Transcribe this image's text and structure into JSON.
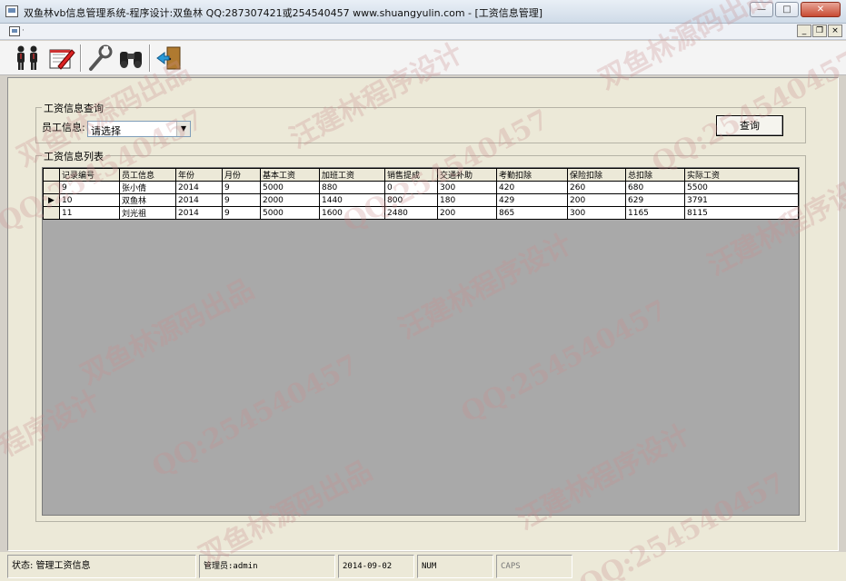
{
  "window": {
    "title": "双鱼林vb信息管理系统-程序设计:双鱼林 QQ:287307421或254540457 www.shuangyulin.com - [工资信息管理]",
    "controls": [
      "minimize",
      "maximize",
      "close"
    ]
  },
  "mdi": {
    "controls": [
      "minimize",
      "restore",
      "close"
    ]
  },
  "toolbar": {
    "icons": [
      "employees-icon",
      "edit-record-icon",
      "tools-icon",
      "search-binoculars-icon",
      "exit-door-icon"
    ]
  },
  "query": {
    "frame_title": "工资信息查询",
    "employee_label": "员工信息:",
    "employee_select_value": "请选择",
    "query_button": "查询"
  },
  "list": {
    "frame_title": "工资信息列表",
    "columns": [
      "记录编号",
      "员工信息",
      "年份",
      "月份",
      "基本工资",
      "加班工资",
      "销售提成",
      "交通补助",
      "考勤扣除",
      "保险扣除",
      "总扣除",
      "实际工资"
    ],
    "rows": [
      [
        "9",
        "张小倩",
        "2014",
        "9",
        "5000",
        "880",
        "0",
        "300",
        "420",
        "260",
        "680",
        "5500"
      ],
      [
        "10",
        "双鱼林",
        "2014",
        "9",
        "2000",
        "1440",
        "800",
        "180",
        "429",
        "200",
        "629",
        "3791"
      ],
      [
        "11",
        "刘光祖",
        "2014",
        "9",
        "5000",
        "1600",
        "2480",
        "200",
        "865",
        "300",
        "1165",
        "8115"
      ]
    ],
    "current_row": 1
  },
  "status": {
    "state": "状态: 管理工资信息",
    "admin": "管理员:admin",
    "date": "2014-09-02",
    "num": "NUM",
    "caps": "CAPS"
  },
  "watermarks": [
    "双鱼林源码出品",
    "QQ:254540457",
    "汪建林程序设计",
    "QQ:254540457",
    "双鱼林源码出品",
    "QQ:254540457",
    "汪建林程序设计",
    "双鱼林源码出品",
    "QQ:254540457",
    "汪建林程序设计",
    "双鱼林源码出品",
    "QQ:254540457",
    "程序设计",
    "汪建林程序设计",
    "QQ:254540457"
  ]
}
